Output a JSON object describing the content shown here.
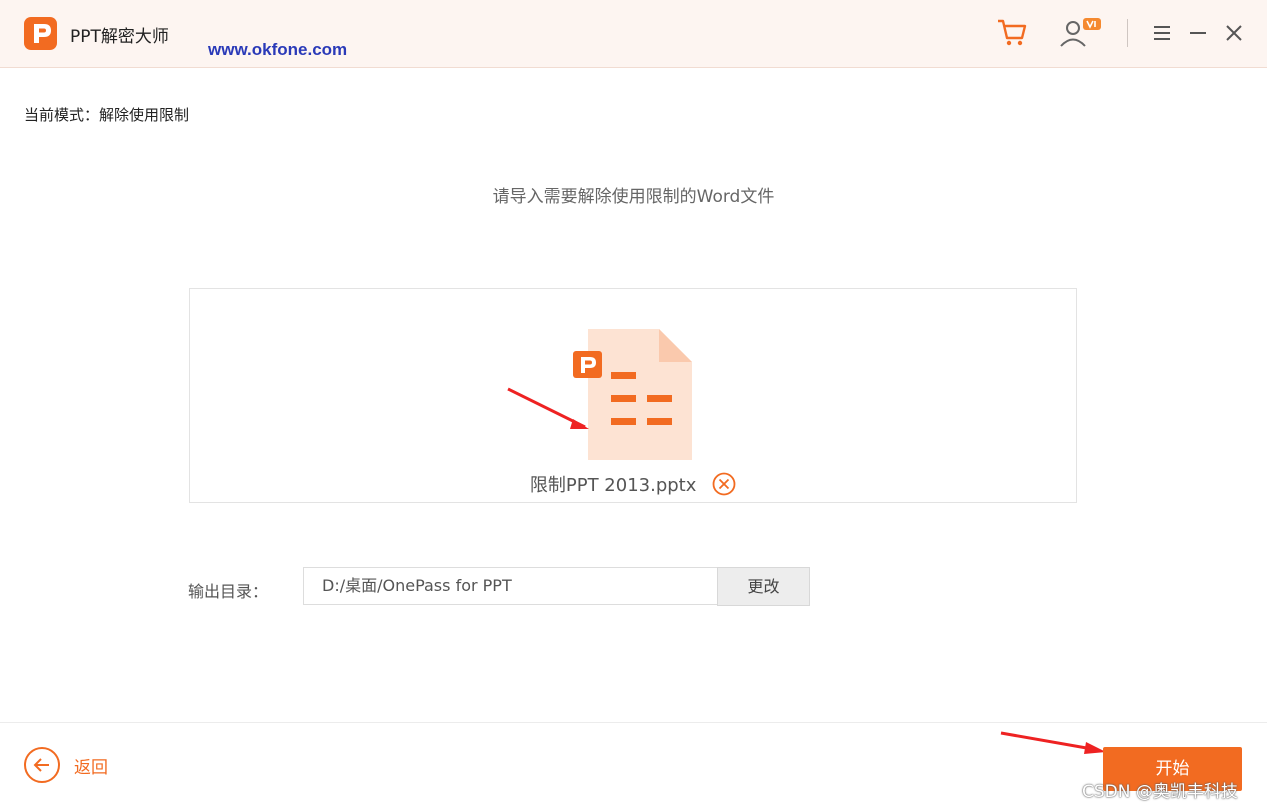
{
  "app": {
    "title": "PPT解密大师",
    "watermark_url": "www.okfone.com",
    "accent_color": "#f26b21"
  },
  "titlebar": {
    "icons": [
      "cart-icon",
      "user-vip-icon",
      "menu-icon",
      "minimize-icon",
      "close-icon"
    ]
  },
  "main": {
    "mode_label": "当前模式：解除使用限制",
    "prompt": "请导入需要解除使用限制的Word文件",
    "file": {
      "name": "限制PPT 2013.pptx",
      "icon": "pptx-file-icon"
    },
    "output": {
      "label": "输出目录：",
      "path": "D:/桌面/OnePass for PPT",
      "change_label": "更改"
    }
  },
  "footer": {
    "back_label": "返回",
    "start_label": "开始"
  },
  "watermark": "CSDN @奥凯丰科技"
}
